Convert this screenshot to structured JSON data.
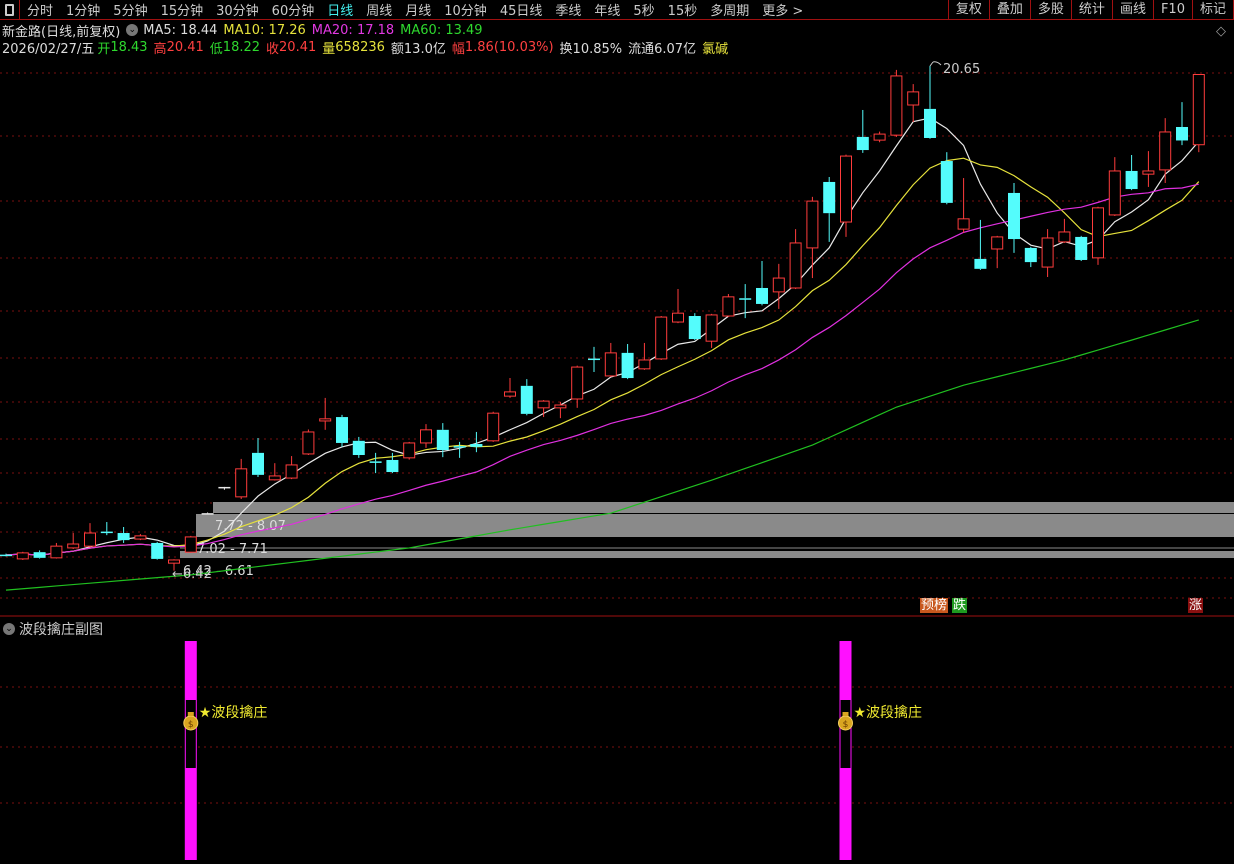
{
  "toolbar": {
    "tabs": [
      "分时",
      "1分钟",
      "5分钟",
      "15分钟",
      "30分钟",
      "60分钟",
      "日线",
      "周线",
      "月线",
      "10分钟",
      "45日线",
      "季线",
      "年线",
      "5秒",
      "15秒",
      "多周期",
      "更多 >"
    ],
    "active_tab": "日线",
    "right_buttons": [
      "复权",
      "叠加",
      "多股",
      "统计",
      "画线",
      "F10",
      "标记"
    ]
  },
  "header": {
    "title": "新金路(日线,前复权)",
    "ma5": "MA5: 18.44",
    "ma10": "MA10: 17.26",
    "ma20": "MA20: 17.18",
    "ma60": "MA60: 13.49"
  },
  "quote": {
    "date": "2026/02/27/五",
    "open_label": "开",
    "open": "18.43",
    "high_label": "高",
    "high": "20.41",
    "low_label": "低",
    "low": "18.22",
    "close_label": "收",
    "close": "20.41",
    "volume_label": "量",
    "volume": "658236",
    "amount": "额13.0亿",
    "change_label": "幅",
    "change": "1.86(10.03%)",
    "turnover": "换10.85%",
    "float_cap": "流通6.07亿",
    "sector": "氯碱"
  },
  "colors": {
    "up": "#ff3c3c",
    "down": "#54fcfc",
    "ma5": "#e8e8e8",
    "ma10": "#e6e23c",
    "ma20": "#e030e0",
    "ma60": "#20c020",
    "zone": "#8a8a8a",
    "signal_bar": "#ff10ff"
  },
  "chart_data": {
    "type": "candlestick",
    "ylim": [
      6.42,
      20.65
    ],
    "candles_ohlc": [
      [
        6.87,
        6.9,
        6.82,
        6.86
      ],
      [
        6.75,
        6.95,
        6.72,
        6.92
      ],
      [
        6.94,
        6.99,
        6.76,
        6.78
      ],
      [
        6.78,
        7.2,
        6.76,
        7.11
      ],
      [
        7.06,
        7.48,
        7.03,
        7.17
      ],
      [
        7.11,
        7.76,
        7.08,
        7.48
      ],
      [
        7.52,
        7.79,
        7.42,
        7.49
      ],
      [
        7.48,
        7.65,
        7.2,
        7.28
      ],
      [
        7.31,
        7.45,
        7.28,
        7.4
      ],
      [
        7.2,
        7.23,
        6.73,
        6.75
      ],
      [
        6.63,
        6.74,
        6.42,
        6.72
      ],
      [
        6.94,
        7.4,
        6.92,
        7.37
      ],
      [
        8.04,
        8.06,
        8.02,
        8.04
      ],
      [
        8.78,
        8.78,
        8.7,
        8.78
      ],
      [
        8.5,
        9.57,
        8.44,
        9.29
      ],
      [
        9.74,
        10.16,
        9.06,
        9.12
      ],
      [
        8.98,
        9.45,
        8.96,
        9.09
      ],
      [
        9.03,
        9.65,
        9.0,
        9.4
      ],
      [
        9.71,
        10.4,
        9.68,
        10.33
      ],
      [
        10.64,
        11.29,
        10.39,
        10.7
      ],
      [
        10.75,
        10.81,
        9.91,
        10.02
      ],
      [
        10.08,
        10.19,
        9.6,
        9.68
      ],
      [
        9.5,
        9.74,
        9.17,
        9.47
      ],
      [
        9.54,
        9.74,
        9.17,
        9.2
      ],
      [
        9.6,
        10.05,
        9.55,
        10.02
      ],
      [
        10.02,
        10.55,
        9.88,
        10.39
      ],
      [
        10.39,
        10.58,
        9.62,
        9.82
      ],
      [
        9.93,
        10.05,
        9.6,
        9.91
      ],
      [
        9.99,
        10.33,
        9.76,
        9.91
      ],
      [
        10.08,
        10.9,
        10.05,
        10.86
      ],
      [
        11.34,
        11.85,
        11.29,
        11.46
      ],
      [
        11.63,
        11.82,
        10.8,
        10.84
      ],
      [
        11.01,
        11.23,
        10.75,
        11.2
      ],
      [
        11.01,
        11.18,
        10.72,
        11.09
      ],
      [
        11.26,
        12.2,
        11.01,
        12.16
      ],
      [
        12.4,
        12.73,
        12.02,
        12.38
      ],
      [
        11.91,
        12.84,
        11.88,
        12.56
      ],
      [
        12.56,
        12.81,
        11.82,
        11.85
      ],
      [
        12.11,
        12.84,
        12.08,
        12.36
      ],
      [
        12.39,
        13.6,
        12.36,
        13.57
      ],
      [
        13.43,
        14.36,
        13.4,
        13.68
      ],
      [
        13.6,
        13.68,
        12.92,
        12.95
      ],
      [
        12.89,
        13.66,
        12.7,
        13.63
      ],
      [
        13.6,
        14.22,
        13.57,
        14.14
      ],
      [
        14.1,
        14.5,
        13.54,
        14.07
      ],
      [
        14.39,
        15.15,
        13.9,
        13.94
      ],
      [
        14.28,
        15.07,
        13.8,
        14.67
      ],
      [
        14.39,
        16.05,
        14.36,
        15.66
      ],
      [
        15.52,
        16.96,
        14.67,
        16.84
      ],
      [
        17.38,
        17.52,
        15.69,
        16.5
      ],
      [
        16.25,
        18.15,
        15.83,
        18.11
      ],
      [
        18.65,
        19.41,
        18.2,
        18.28
      ],
      [
        18.56,
        18.8,
        18.5,
        18.73
      ],
      [
        18.7,
        20.54,
        18.65,
        20.37
      ],
      [
        19.55,
        20.14,
        19.07,
        19.92
      ],
      [
        19.44,
        20.65,
        18.6,
        18.62
      ],
      [
        17.97,
        18.22,
        16.75,
        16.79
      ],
      [
        16.05,
        17.49,
        15.95,
        16.34
      ],
      [
        15.21,
        16.31,
        14.9,
        14.93
      ],
      [
        15.49,
        15.86,
        14.95,
        15.83
      ],
      [
        17.07,
        17.35,
        15.38,
        15.77
      ],
      [
        15.52,
        15.55,
        14.98,
        15.12
      ],
      [
        14.98,
        16.05,
        14.7,
        15.8
      ],
      [
        15.69,
        16.34,
        15.66,
        15.97
      ],
      [
        15.83,
        15.86,
        15.15,
        15.18
      ],
      [
        15.24,
        16.68,
        15.04,
        16.65
      ],
      [
        16.45,
        18.08,
        16.42,
        17.69
      ],
      [
        17.69,
        18.14,
        17.15,
        17.18
      ],
      [
        17.6,
        18.25,
        17.24,
        17.69
      ],
      [
        17.72,
        19.18,
        17.35,
        18.79
      ],
      [
        18.93,
        19.63,
        18.42,
        18.55
      ],
      [
        18.43,
        20.41,
        18.22,
        20.41
      ]
    ],
    "ma60_anchors": [
      [
        0,
        5.87
      ],
      [
        11,
        6.3
      ],
      [
        24,
        7.06
      ],
      [
        30,
        7.57
      ],
      [
        36,
        8.04
      ],
      [
        42,
        8.97
      ],
      [
        48,
        9.96
      ],
      [
        53,
        11.03
      ],
      [
        57,
        11.65
      ],
      [
        63,
        12.36
      ],
      [
        67,
        12.92
      ],
      [
        71,
        13.49
      ]
    ],
    "high_marker": {
      "index": 55,
      "label": "20.65"
    },
    "low_marker": {
      "index": 10,
      "label": "←6.42"
    },
    "zones": [
      {
        "from": 8.07,
        "to": 8.4,
        "start_index": 12,
        "label": ""
      },
      {
        "from": 7.72,
        "to": 8.07,
        "start_index": 11,
        "label": "7.72 - 8.07"
      },
      {
        "from": 7.02,
        "to": 7.24,
        "start_index": 10,
        "label": "7.02 - 7.71"
      },
      {
        "from": 6.42,
        "to": 6.61,
        "start_index": 10,
        "label": "6.42 - 6.61"
      }
    ]
  },
  "signals": {
    "yubang": "预榜",
    "die": "跌",
    "zhang": "涨"
  },
  "subchart": {
    "title": "波段擒庄副图",
    "markers": [
      {
        "index": 11,
        "label": "★波段擒庄"
      },
      {
        "index": 50,
        "label": "★波段擒庄"
      }
    ]
  }
}
